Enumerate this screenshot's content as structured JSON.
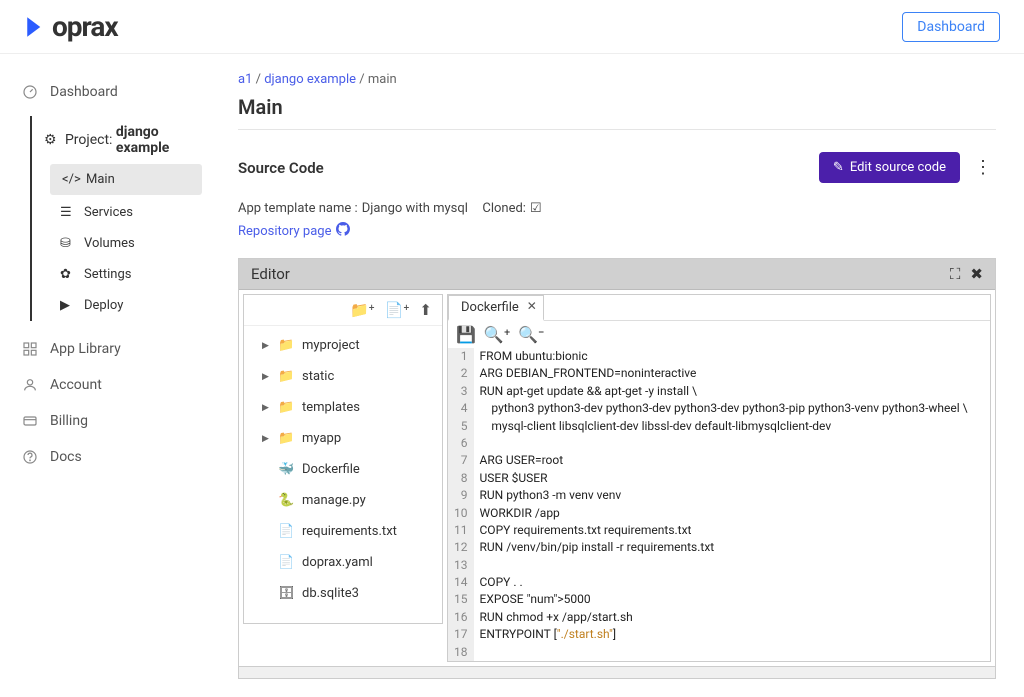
{
  "topbar": {
    "brand": "oprax",
    "dashBtn": "Dashboard"
  },
  "sidebar": {
    "items": [
      {
        "key": "dashboard",
        "label": "Dashboard"
      },
      {
        "key": "project",
        "label": "Project:",
        "project": "django example",
        "children": [
          {
            "key": "main",
            "label": "Main"
          },
          {
            "key": "services",
            "label": "Services"
          },
          {
            "key": "volumes",
            "label": "Volumes"
          },
          {
            "key": "settings",
            "label": "Settings"
          },
          {
            "key": "deploy",
            "label": "Deploy"
          }
        ]
      },
      {
        "key": "applib",
        "label": "App Library"
      },
      {
        "key": "account",
        "label": "Account"
      },
      {
        "key": "billing",
        "label": "Billing"
      },
      {
        "key": "docs",
        "label": "Docs"
      }
    ]
  },
  "breadcrumb": {
    "a": "a1",
    "b": "django example",
    "c": "main"
  },
  "page": {
    "title": "Main",
    "sectionTitle": "Source Code",
    "templateLabel": "App template name :",
    "templateName": "Django with mysql",
    "clonedLabel": "Cloned:",
    "repoLink": "Repository page",
    "editBtn": "Edit source code",
    "editorTitle": "Editor",
    "tabName": "Dockerfile"
  },
  "filetree": [
    {
      "name": "myproject",
      "type": "folder"
    },
    {
      "name": "static",
      "type": "folder"
    },
    {
      "name": "templates",
      "type": "folder"
    },
    {
      "name": "myapp",
      "type": "folder"
    },
    {
      "name": "Dockerfile",
      "type": "docker"
    },
    {
      "name": "manage.py",
      "type": "python"
    },
    {
      "name": "requirements.txt",
      "type": "file"
    },
    {
      "name": "doprax.yaml",
      "type": "file"
    },
    {
      "name": "db.sqlite3",
      "type": "db"
    }
  ],
  "code": {
    "lines": [
      "FROM ubuntu:bionic",
      "ARG DEBIAN_FRONTEND=noninteractive",
      "RUN apt-get update && apt-get -y install \\",
      "    python3 python3-dev python3-dev python3-dev python3-pip python3-venv python3-wheel \\",
      "    mysql-client libsqlclient-dev libssl-dev default-libmysqlclient-dev",
      "",
      "ARG USER=root",
      "USER $USER",
      "RUN python3 -m venv venv",
      "WORKDIR /app",
      "COPY requirements.txt requirements.txt",
      "RUN /venv/bin/pip install -r requirements.txt",
      "",
      "COPY . .",
      "EXPOSE 5000",
      "RUN chmod +x /app/start.sh",
      "ENTRYPOINT [\"./start.sh\"]",
      ""
    ]
  }
}
